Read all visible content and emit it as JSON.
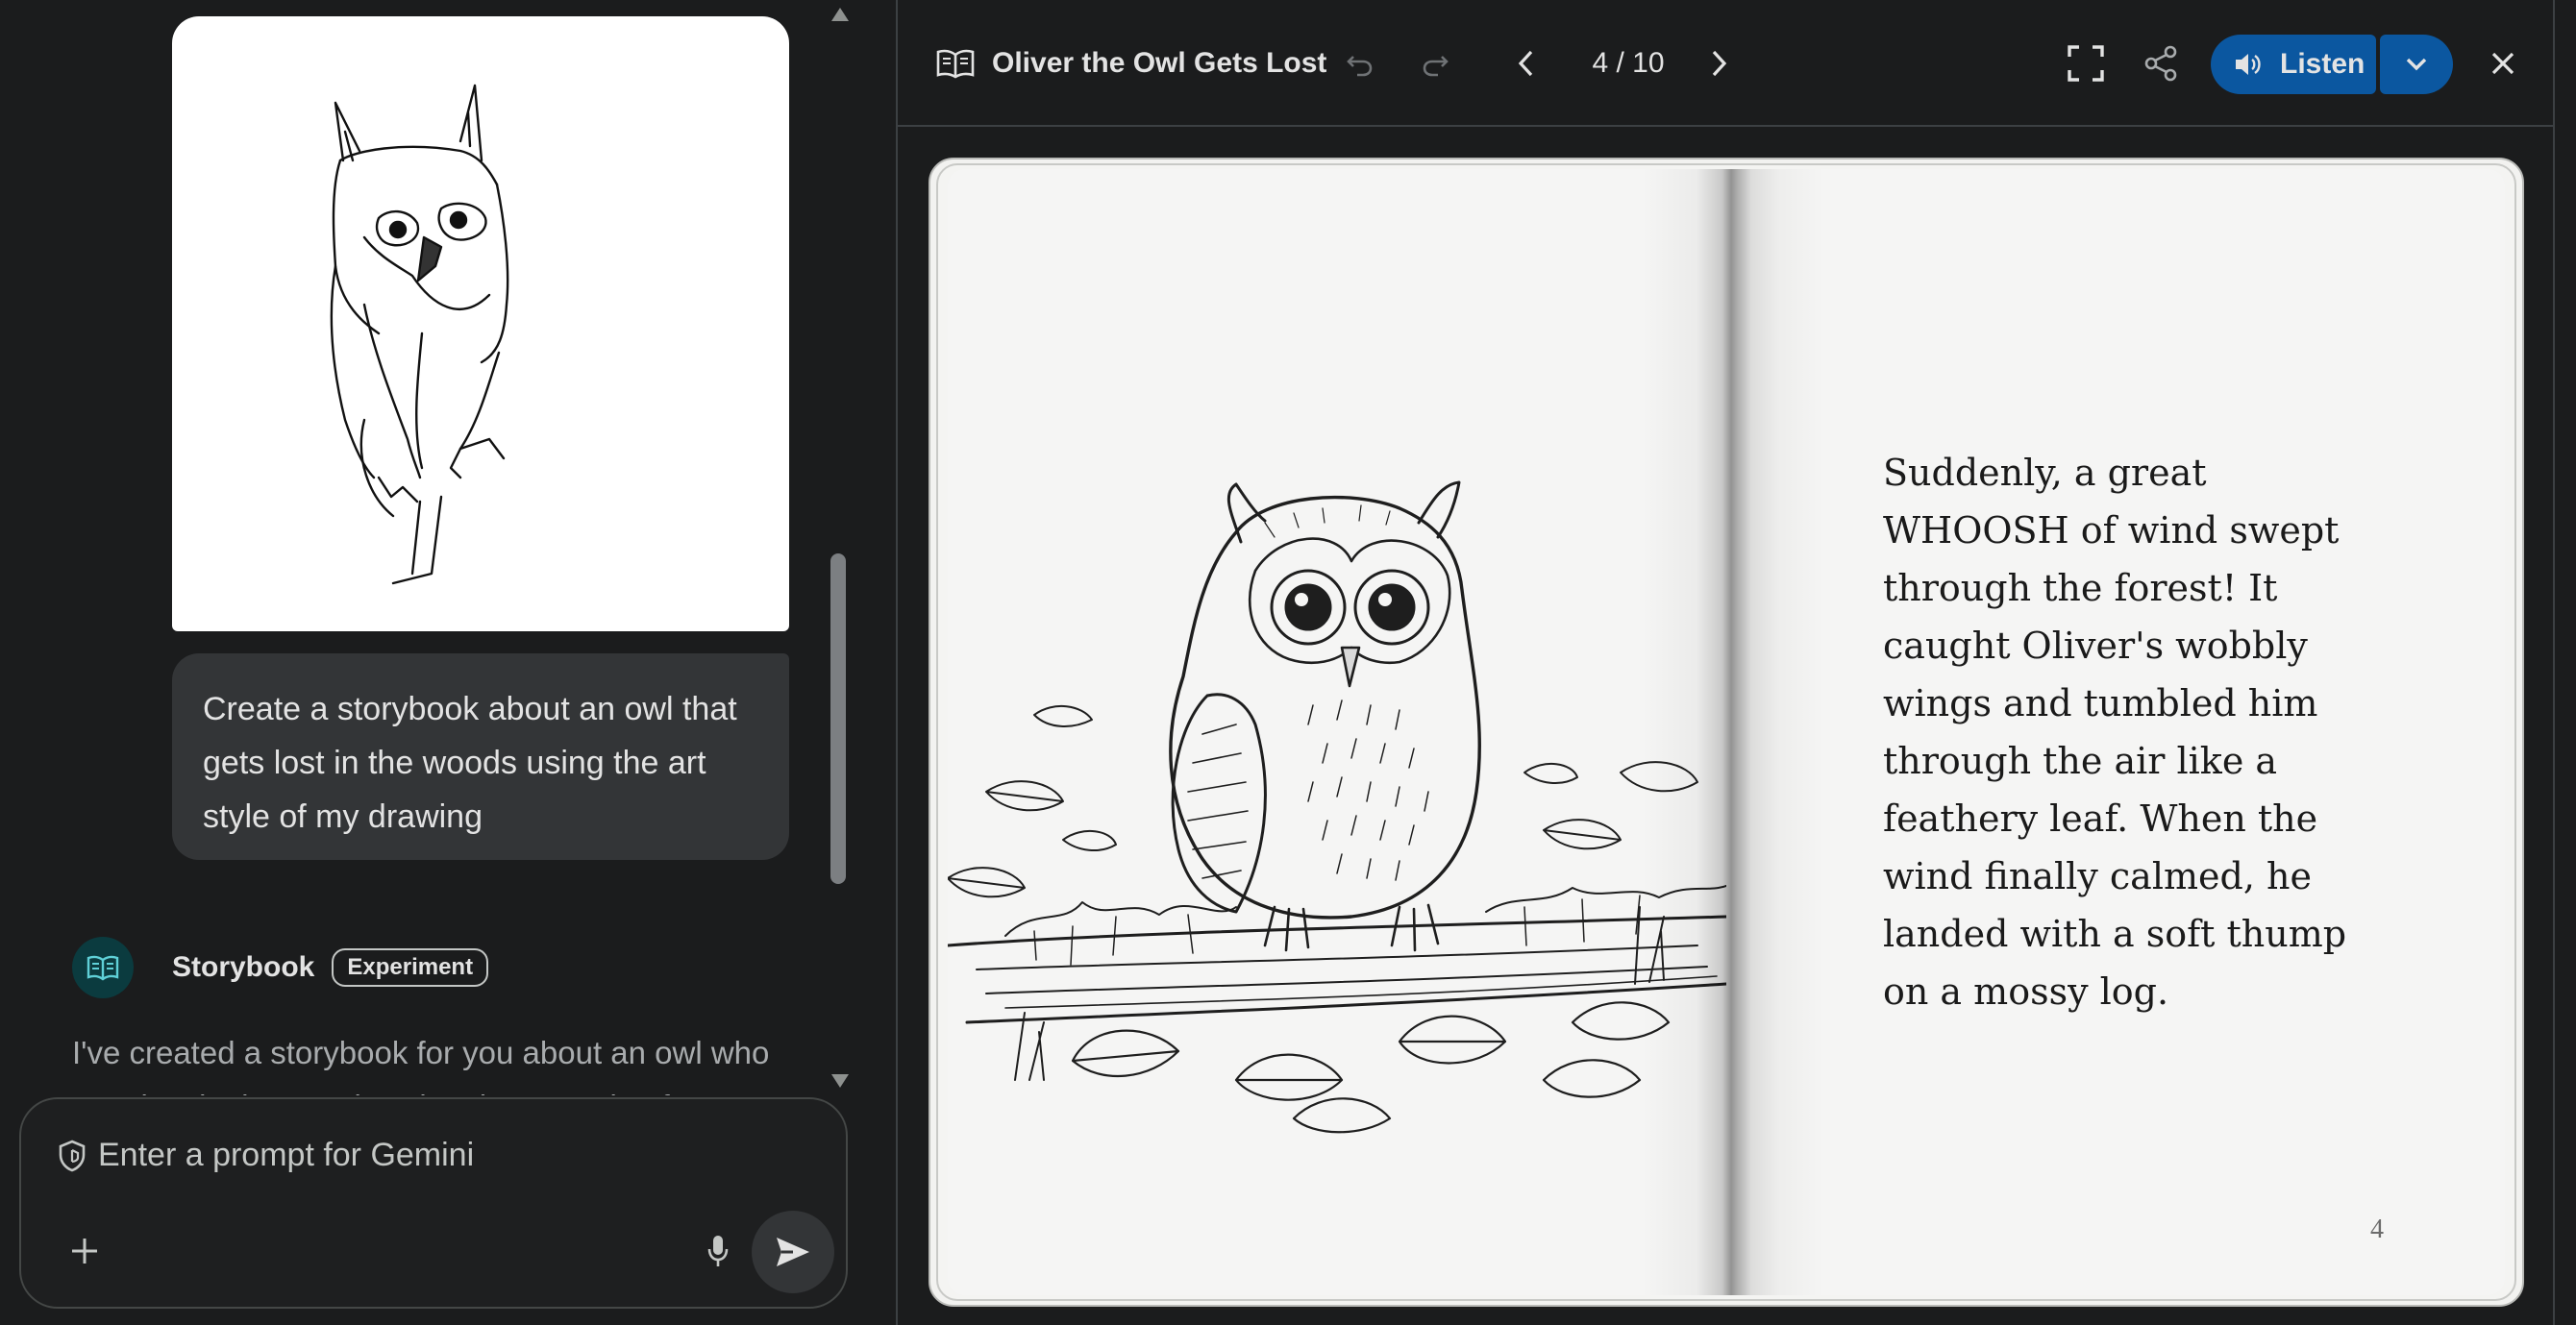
{
  "chat": {
    "user_prompt": "Create a storybook about an owl that gets lost in the woods using the art style of my drawing",
    "bot_name": "Storybook",
    "bot_badge": "Experiment",
    "bot_response": "I've created a storybook for you about an owl who gets lost in the woods using the art style of your drawing."
  },
  "prompt": {
    "placeholder": "Enter a prompt for Gemini"
  },
  "book": {
    "title": "Oliver the Owl Gets Lost",
    "page_indicator": "4 / 10",
    "listen_label": "Listen",
    "story_text": "Suddenly, a great WHOOSH of wind swept through the forest! It caught Oliver's wobbly wings and tumbled him through the air like a feathery leaf. When the wind finally calmed, he landed with a soft thump on a mossy log.",
    "page_number": "4"
  },
  "icons": {
    "bot_avatar": "book-open-icon",
    "prompt_shield": "shield-icon",
    "prompt_plus": "plus-icon",
    "prompt_mic": "mic-icon",
    "prompt_send": "send-icon",
    "title": "book-open-icon",
    "undo": "undo-icon",
    "redo": "redo-icon",
    "prev": "chevron-left-icon",
    "next": "chevron-right-icon",
    "fullscreen": "fullscreen-icon",
    "share": "share-icon",
    "listen": "speaker-icon",
    "dropdown": "chevron-down-icon",
    "close": "close-icon"
  },
  "colors": {
    "background": "#1b1c1d",
    "user_bubble": "#333537",
    "accent_button": "#0b57a0",
    "bot_avatar": "#0b3b3f",
    "page": "#f5f5f4"
  }
}
